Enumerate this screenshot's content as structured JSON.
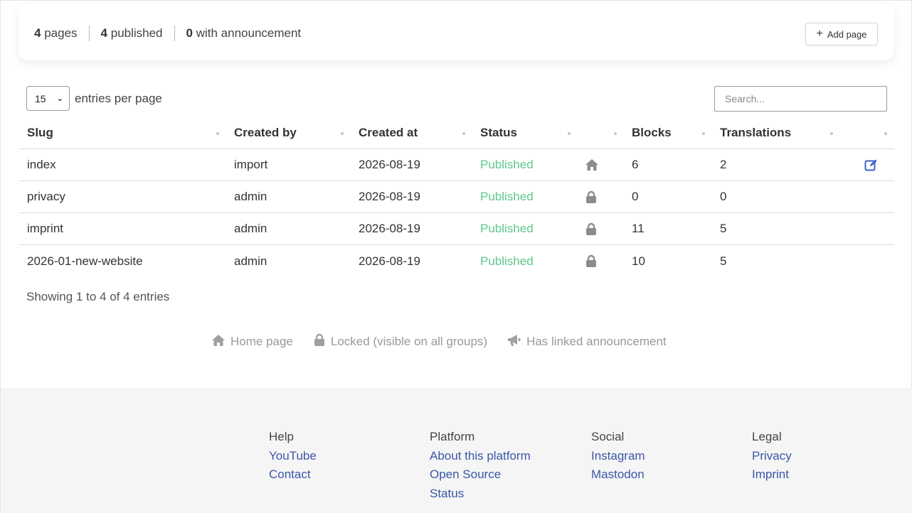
{
  "summary": {
    "pages_count": "4",
    "pages_label": "pages",
    "published_count": "4",
    "published_label": "published",
    "announcement_count": "0",
    "announcement_label": "with announcement",
    "add_button_label": "Add page"
  },
  "controls": {
    "per_page_value": "15",
    "per_page_label": "entries per page",
    "search_placeholder": "Search..."
  },
  "table": {
    "columns": [
      "Slug",
      "Created by",
      "Created at",
      "Status",
      "",
      "Blocks",
      "Translations",
      ""
    ],
    "rows": [
      {
        "slug": "index",
        "created_by": "import",
        "created_at": "2026-08-19",
        "status": "Published",
        "icon": "home-icon",
        "blocks": "6",
        "translations": "2",
        "editable": true
      },
      {
        "slug": "privacy",
        "created_by": "admin",
        "created_at": "2026-08-19",
        "status": "Published",
        "icon": "lock-icon",
        "blocks": "0",
        "translations": "0",
        "editable": false
      },
      {
        "slug": "imprint",
        "created_by": "admin",
        "created_at": "2026-08-19",
        "status": "Published",
        "icon": "lock-icon",
        "blocks": "11",
        "translations": "5",
        "editable": false
      },
      {
        "slug": "2026-01-new-website",
        "created_by": "admin",
        "created_at": "2026-08-19",
        "status": "Published",
        "icon": "lock-icon",
        "blocks": "10",
        "translations": "5",
        "editable": false
      }
    ],
    "showing": "Showing 1 to 4 of 4 entries"
  },
  "legend": {
    "home": "Home page",
    "locked": "Locked (visible on all groups)",
    "announcement": "Has linked announcement"
  },
  "colors": {
    "status_published": "#5cc78b",
    "link": "#3a57a7",
    "edit_icon": "#3f5fc4"
  },
  "footer": {
    "help": {
      "title": "Help",
      "links": [
        "YouTube",
        "Contact"
      ]
    },
    "platform": {
      "title": "Platform",
      "links": [
        "About this platform",
        "Open Source",
        "Status"
      ]
    },
    "social": {
      "title": "Social",
      "links": [
        "Instagram",
        "Mastodon"
      ]
    },
    "legal": {
      "title": "Legal",
      "links": [
        "Privacy",
        "Imprint"
      ]
    }
  }
}
